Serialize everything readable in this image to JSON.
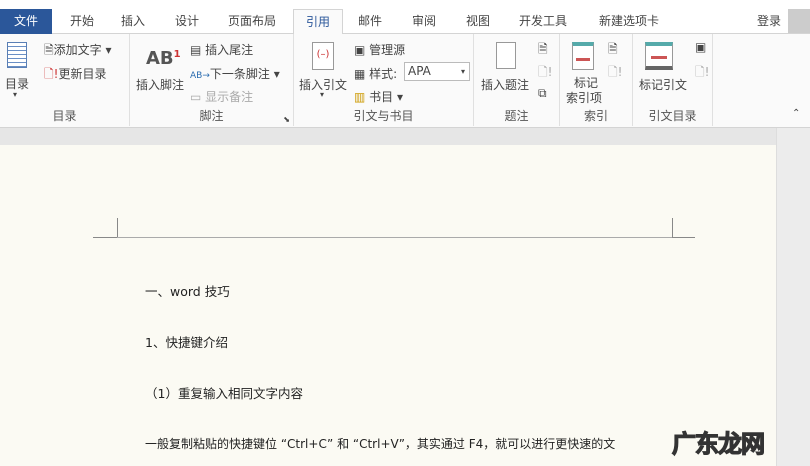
{
  "tabs": [
    "文件",
    "开始",
    "插入",
    "设计",
    "页面布局",
    "引用",
    "邮件",
    "审阅",
    "视图",
    "开发工具",
    "新建选项卡"
  ],
  "login": "登录",
  "groups": {
    "toc": {
      "label": "目录",
      "big": "目录",
      "add_text": "添加文字",
      "update": "更新目录"
    },
    "footnote": {
      "label": "脚注",
      "insert_footnote": "插入脚注",
      "insert_endnote": "插入尾注",
      "next_footnote": "下一条脚注",
      "show_notes": "显示备注",
      "ab": "AB",
      "sup": "1"
    },
    "citation": {
      "label": "引文与书目",
      "insert_citation": "插入引文",
      "manage_sources": "管理源",
      "style_label": "样式:",
      "style_value": "APA",
      "bibliography": "书目"
    },
    "caption": {
      "label": "题注",
      "insert_caption": "插入题注"
    },
    "index": {
      "label": "索引",
      "mark_entry_1": "标记",
      "mark_entry_2": "索引项"
    },
    "toa": {
      "label": "引文目录",
      "mark_citation": "标记引文"
    }
  },
  "document": {
    "lines": [
      "一、word 技巧",
      "1、快捷键介绍",
      "（1）重复输入相同文字内容",
      "一般复制粘贴的快捷键位 “Ctrl+C” 和 “Ctrl+V”，其实通过 F4，就可以进行更快速的文"
    ]
  },
  "watermark": "广东龙网"
}
